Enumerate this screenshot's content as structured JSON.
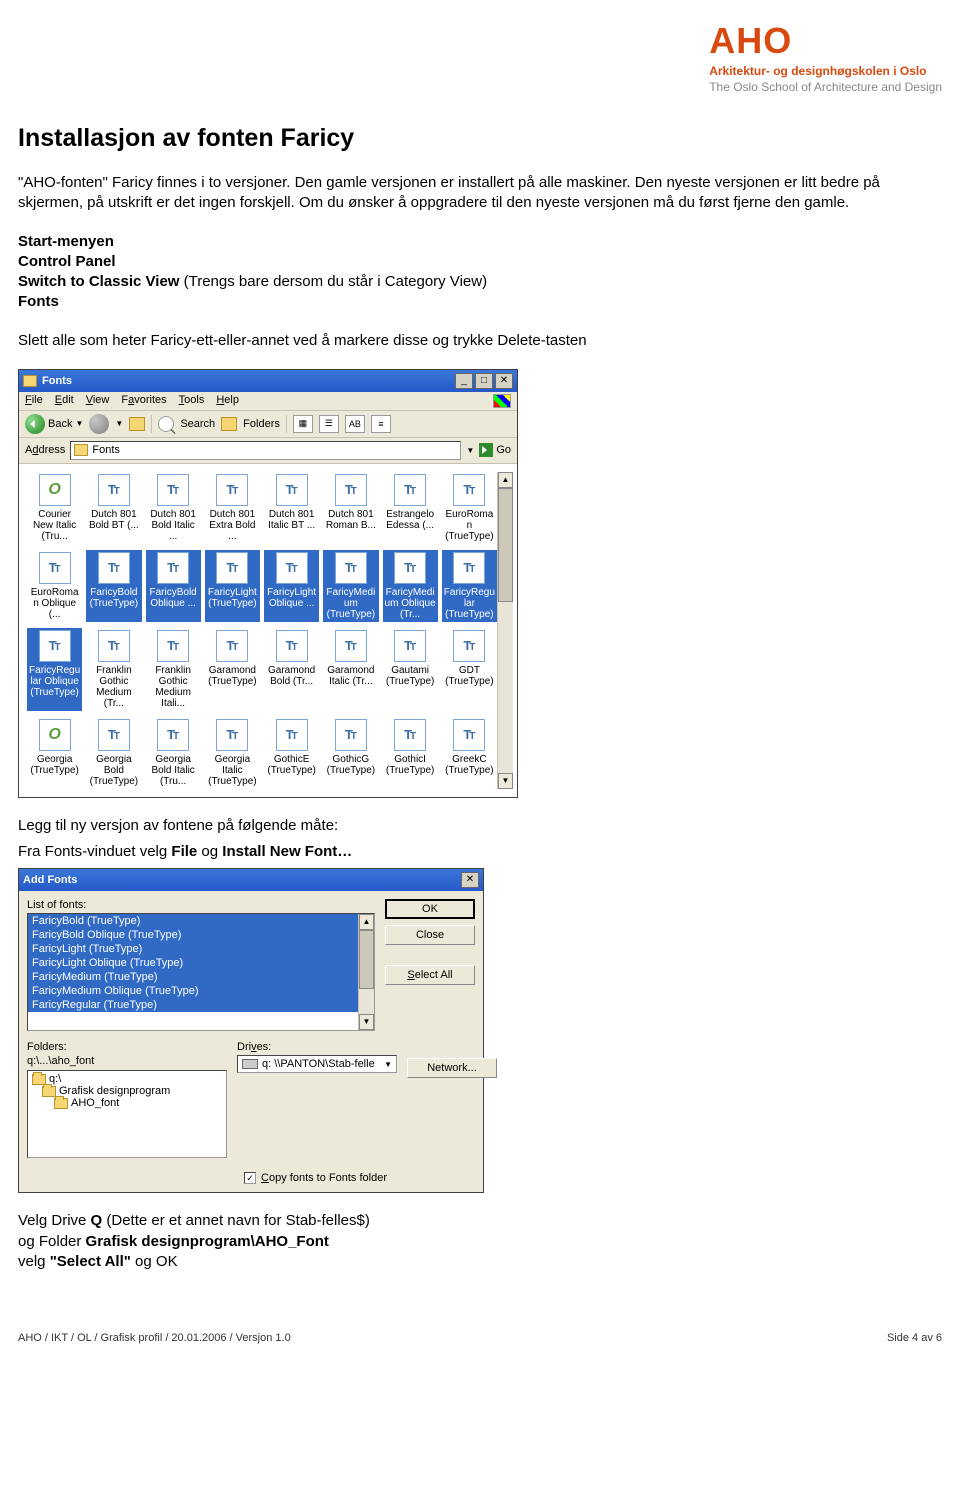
{
  "header": {
    "logo_main": "AHO",
    "logo_sub": "Arkitektur- og designhøgskolen i Oslo",
    "logo_sub2": "The Oslo School of Architecture and Design"
  },
  "title": "Installasjon av fonten Faricy",
  "intro1": "\"AHO-fonten\" Faricy finnes i to versjoner. Den gamle versjonen er installert på alle maskiner. Den nyeste versjonen er litt bedre på skjermen, på utskrift er det ingen forskjell. Om du ønsker å oppgradere til den nyeste versjonen må du først fjerne den gamle.",
  "steps": {
    "s1": "Start-menyen",
    "s2": "Control Panel",
    "s3a": "Switch to Classic View",
    "s3b": " (Trengs bare dersom du står i Category View)",
    "s4": "Fonts"
  },
  "intro2": "Slett alle som heter Faricy-ett-eller-annet ved å markere disse og trykke Delete-tasten",
  "fonts_window": {
    "title": "Fonts",
    "menu": [
      "File",
      "Edit",
      "View",
      "Favorites",
      "Tools",
      "Help"
    ],
    "back": "Back",
    "search": "Search",
    "folders": "Folders",
    "address_label": "Address",
    "address_value": "Fonts",
    "go": "Go",
    "items": [
      {
        "label": "Courier New Italic (Tru...",
        "type": "o",
        "sel": false
      },
      {
        "label": "Dutch 801 Bold BT (...",
        "type": "tt",
        "sel": false
      },
      {
        "label": "Dutch 801 Bold Italic ...",
        "type": "tt",
        "sel": false
      },
      {
        "label": "Dutch 801 Extra Bold ...",
        "type": "tt",
        "sel": false
      },
      {
        "label": "Dutch 801 Italic BT ...",
        "type": "tt",
        "sel": false
      },
      {
        "label": "Dutch 801 Roman B...",
        "type": "tt",
        "sel": false
      },
      {
        "label": "Estrangelo Edessa (...",
        "type": "tt",
        "sel": false
      },
      {
        "label": "EuroRoman (TrueType)",
        "type": "tt",
        "sel": false
      },
      {
        "label": "EuroRoman Oblique (...",
        "type": "tt",
        "sel": false
      },
      {
        "label": "FaricyBold (TrueType)",
        "type": "tt",
        "sel": true
      },
      {
        "label": "FaricyBold Oblique ...",
        "type": "tt",
        "sel": true
      },
      {
        "label": "FaricyLight (TrueType)",
        "type": "tt",
        "sel": true
      },
      {
        "label": "FaricyLight Oblique ...",
        "type": "tt",
        "sel": true
      },
      {
        "label": "FaricyMedium (TrueType)",
        "type": "tt",
        "sel": true
      },
      {
        "label": "FaricyMedium Oblique (Tr...",
        "type": "tt",
        "sel": true
      },
      {
        "label": "FaricyRegular (TrueType)",
        "type": "tt",
        "sel": true
      },
      {
        "label": "FaricyRegular Oblique (TrueType)",
        "type": "tt",
        "sel": true
      },
      {
        "label": "Franklin Gothic Medium (Tr...",
        "type": "tt",
        "sel": false
      },
      {
        "label": "Franklin Gothic Medium Itali...",
        "type": "tt",
        "sel": false
      },
      {
        "label": "Garamond (TrueType)",
        "type": "tt",
        "sel": false
      },
      {
        "label": "Garamond Bold (Tr...",
        "type": "tt",
        "sel": false
      },
      {
        "label": "Garamond Italic (Tr...",
        "type": "tt",
        "sel": false
      },
      {
        "label": "Gautami (TrueType)",
        "type": "tt",
        "sel": false
      },
      {
        "label": "GDT (TrueType)",
        "type": "tt",
        "sel": false
      },
      {
        "label": "Georgia (TrueType)",
        "type": "o",
        "sel": false
      },
      {
        "label": "Georgia Bold (TrueType)",
        "type": "tt",
        "sel": false
      },
      {
        "label": "Georgia Bold Italic (Tru...",
        "type": "tt",
        "sel": false
      },
      {
        "label": "Georgia Italic (TrueType)",
        "type": "tt",
        "sel": false
      },
      {
        "label": "GothicE (TrueType)",
        "type": "tt",
        "sel": false
      },
      {
        "label": "GothicG (TrueType)",
        "type": "tt",
        "sel": false
      },
      {
        "label": "GothicI (TrueType)",
        "type": "tt",
        "sel": false
      },
      {
        "label": "GreekC (TrueType)",
        "type": "tt",
        "sel": false
      }
    ]
  },
  "caption2a": "Legg til ny versjon av fontene på følgende måte:",
  "caption2b_pre": "Fra Fonts-vinduet velg ",
  "caption2b_b1": "File",
  "caption2b_mid": " og ",
  "caption2b_b2": "Install New Font…",
  "addfonts": {
    "title": "Add Fonts",
    "list_label": "List of fonts:",
    "fonts": [
      "FaricyBold (TrueType)",
      "FaricyBold Oblique (TrueType)",
      "FaricyLight (TrueType)",
      "FaricyLight Oblique (TrueType)",
      "FaricyMedium (TrueType)",
      "FaricyMedium Oblique (TrueType)",
      "FaricyRegular (TrueType)"
    ],
    "ok": "OK",
    "close": "Close",
    "select_all": "Select All",
    "folders_label": "Folders:",
    "folders_path": "q:\\...\\aho_font",
    "folder_tree": [
      "q:\\",
      "Grafisk designprogram",
      "AHO_font"
    ],
    "drives_label": "Drives:",
    "drive_value": "q: \\\\PANTON\\Stab-felle",
    "network": "Network...",
    "copy_check": "Copy fonts to Fonts folder"
  },
  "final": {
    "l1a": "Velg Drive ",
    "l1b": "Q",
    "l1c": " (Dette er et annet navn for Stab-felles$)",
    "l2a": "og Folder ",
    "l2b": "Grafisk designprogram\\AHO_Font",
    "l3a": "velg ",
    "l3b": "\"Select All\"",
    "l3c": " og OK"
  },
  "footer": {
    "left": "AHO / IKT / OL / Grafisk profil / 20.01.2006 / Versjon 1.0",
    "right": "Side 4 av 6"
  }
}
